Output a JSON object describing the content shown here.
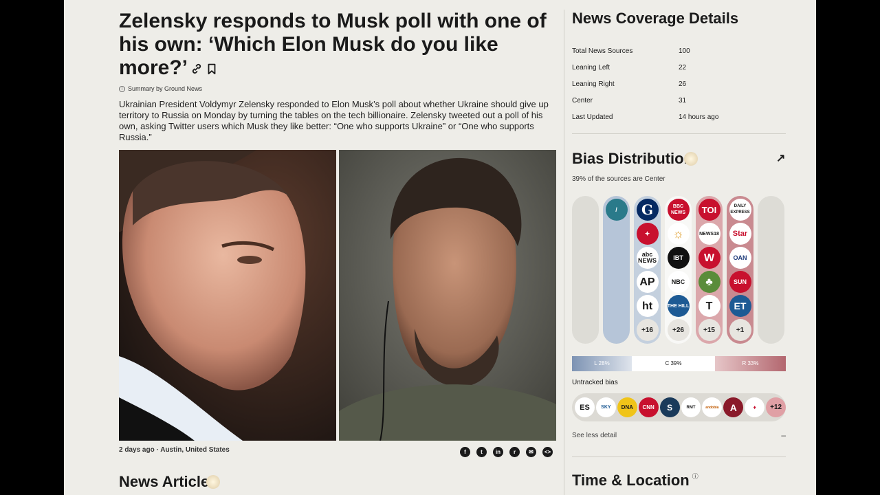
{
  "article": {
    "title": "Zelensky responds to Musk poll with one of his own: ‘Which Elon Musk do you like more?’",
    "summary_by": "Summary by Ground News",
    "summary": "Ukrainian President Voldymyr Zelensky responded to Elon Musk’s poll about whether Ukraine should give up territory to Russia on Monday by turning the tables on the tech billionaire. Zelensky tweeted out a poll of his own, asking Twitter users which Musk they like better: “One who supports Ukraine” or “One who supports Russia.”",
    "age": "2 days ago",
    "location": "Austin, United States",
    "news_articles_heading": "News Article"
  },
  "coverage": {
    "title": "News Coverage Details",
    "rows": [
      {
        "k": "Total News Sources",
        "v": "100"
      },
      {
        "k": "Leaning Left",
        "v": "22"
      },
      {
        "k": "Leaning Right",
        "v": "26"
      },
      {
        "k": "Center",
        "v": "31"
      },
      {
        "k": "Last Updated",
        "v": "14 hours ago"
      }
    ]
  },
  "bias": {
    "title": "Bias Distributior",
    "subtitle": "39% of the sources are Center",
    "left_label": "L 28%",
    "center_label": "C 39%",
    "right_label": "R 33%",
    "left_pct": 28,
    "center_pct": 39,
    "right_pct": 33,
    "columns": [
      {
        "logos": []
      },
      {
        "logos": [
          {
            "t": "/",
            "cls": "teal"
          }
        ]
      },
      {
        "logos": [
          {
            "t": "G",
            "cls": "guardian"
          },
          {
            "t": "✦",
            "cls": "red"
          },
          {
            "t": "abc NEWS",
            "cls": ""
          },
          {
            "t": "AP",
            "cls": ""
          },
          {
            "t": "ht",
            "cls": ""
          }
        ],
        "more": "+16"
      },
      {
        "logos": [
          {
            "t": "BBC NEWS",
            "cls": "red"
          },
          {
            "t": "☼",
            "cls": ""
          },
          {
            "t": "IBT",
            "cls": "dark"
          },
          {
            "t": "NBC",
            "cls": ""
          },
          {
            "t": "THE HILL",
            "cls": "blue"
          }
        ],
        "more": "+26"
      },
      {
        "logos": [
          {
            "t": "TOI",
            "cls": "red"
          },
          {
            "t": "NEWS18",
            "cls": ""
          },
          {
            "t": "W",
            "cls": "red"
          },
          {
            "t": "♣",
            "cls": "green"
          },
          {
            "t": "T",
            "cls": ""
          }
        ],
        "more": "+15"
      },
      {
        "logos": [
          {
            "t": "DAILY EXPRESS",
            "cls": ""
          },
          {
            "t": "Star",
            "cls": ""
          },
          {
            "t": "OAN",
            "cls": ""
          },
          {
            "t": "SUN",
            "cls": "red"
          },
          {
            "t": "ET",
            "cls": "blue"
          }
        ],
        "more": "+1"
      },
      {
        "logos": []
      }
    ],
    "untracked_label": "Untracked bias",
    "untracked": [
      "ES",
      "SKY",
      "DNA",
      "CNN",
      "S",
      "RMT",
      "andobia",
      "A",
      "♦",
      "+12"
    ],
    "see_less": "See less detail",
    "minus": "–"
  },
  "time_location": {
    "title": "Time & Location",
    "info": "ⓘ"
  },
  "share_icons": [
    "f",
    "t",
    "in",
    "r",
    "✉",
    "<>"
  ]
}
